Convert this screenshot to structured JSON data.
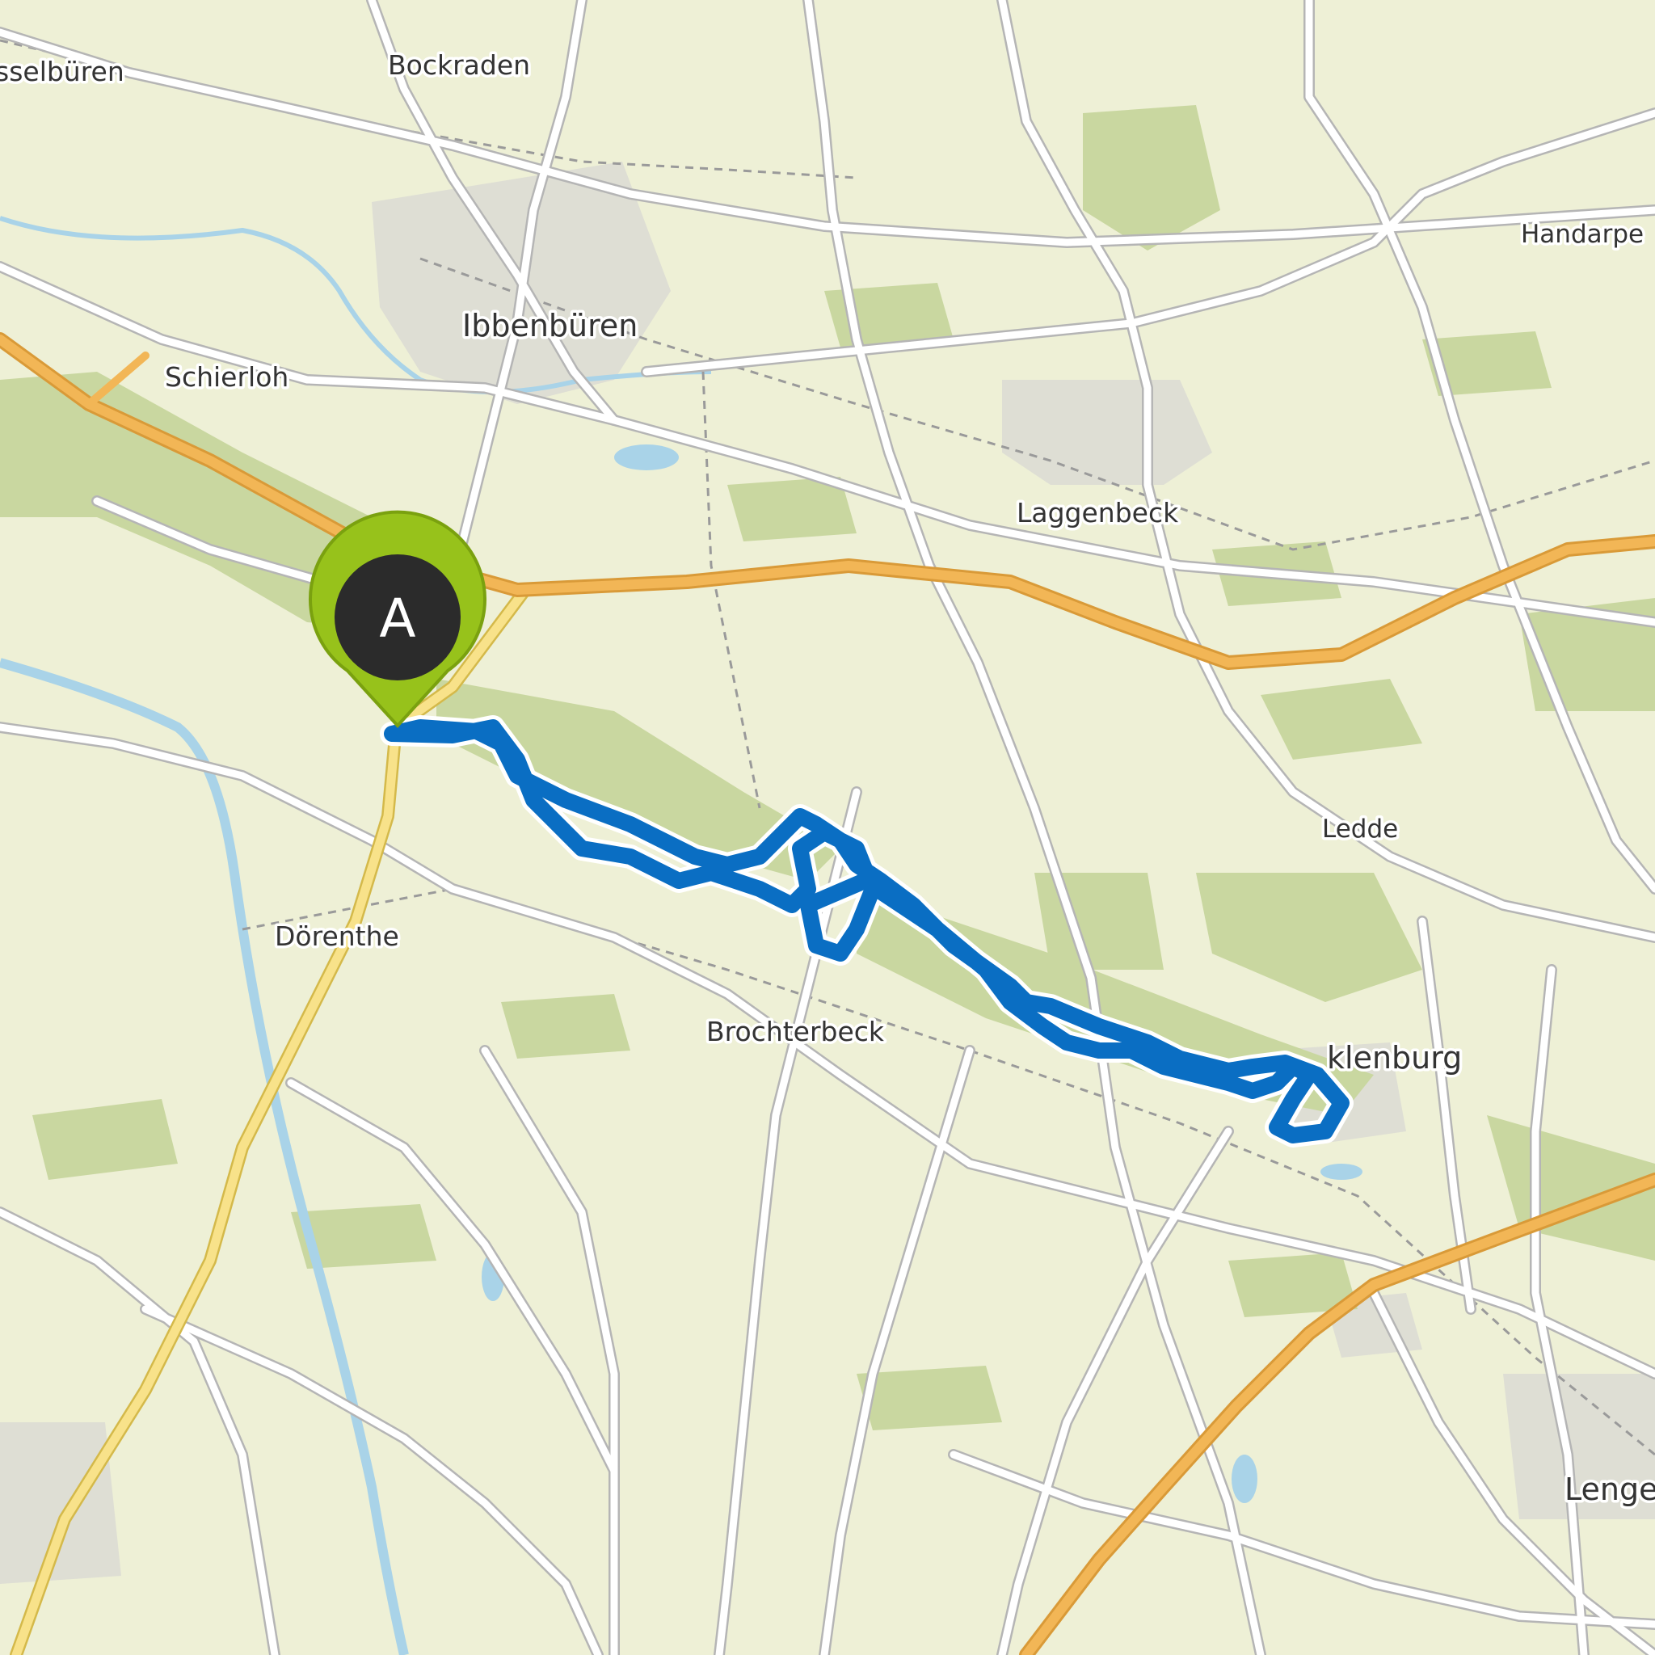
{
  "map": {
    "place_labels": [
      {
        "id": "esselbueren",
        "text": "sselbüren"
      },
      {
        "id": "bockraden",
        "text": "Bockraden"
      },
      {
        "id": "handarpe",
        "text": "Handarpe"
      },
      {
        "id": "ibbenbueren",
        "text": "Ibbenbüren"
      },
      {
        "id": "schierloh",
        "text": "Schierloh"
      },
      {
        "id": "laggenbeck",
        "text": "Laggenbeck"
      },
      {
        "id": "ledde",
        "text": "Ledde"
      },
      {
        "id": "doerenthe",
        "text": "Dörenthe"
      },
      {
        "id": "brochterbeck",
        "text": "Brochterbeck"
      },
      {
        "id": "tecklenburg",
        "text": "klenburg"
      },
      {
        "id": "lengerich",
        "text": "Lenge"
      }
    ],
    "start_marker": {
      "label": "A"
    },
    "colors": {
      "background": "#eef0d6",
      "forest": "#c9d7a0",
      "road": "#ffffff",
      "road_casing": "#b5b5b5",
      "motorway": "#f2b656",
      "motorway_casing": "#d99a38",
      "secondary_road": "#f8e28a",
      "water": "#a9d3e8",
      "urban": "#dcdcd4",
      "route": "#0a6ec3",
      "marker_fill": "#97c21b",
      "marker_inner": "#2b2b2b"
    }
  }
}
